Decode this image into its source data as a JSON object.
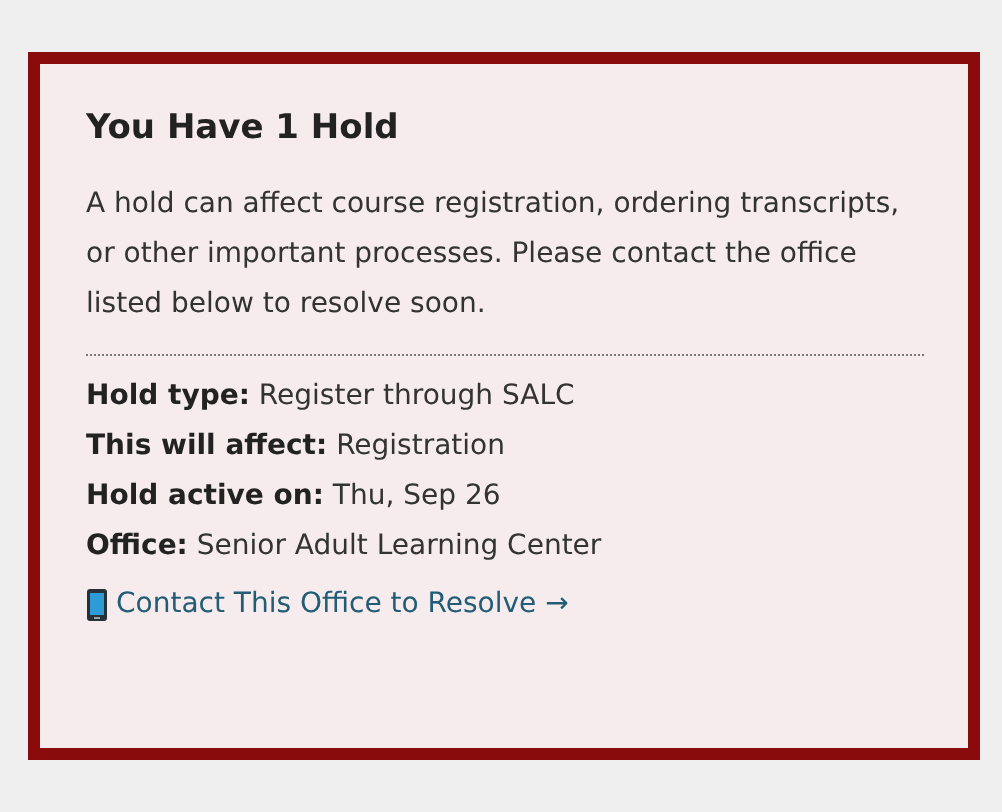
{
  "card": {
    "title": "You Have 1 Hold",
    "description": "A hold can affect course registration, ordering transcripts, or other important processes. Please contact the office listed below to resolve soon.",
    "details": [
      {
        "label": "Hold type:",
        "value": "Register through SALC"
      },
      {
        "label": "This will affect:",
        "value": "Registration"
      },
      {
        "label": "Hold active on:",
        "value": "Thu, Sep 26"
      },
      {
        "label": "Office:",
        "value": "Senior Adult Learning Center"
      }
    ],
    "link": "Contact This Office to Resolve →"
  }
}
